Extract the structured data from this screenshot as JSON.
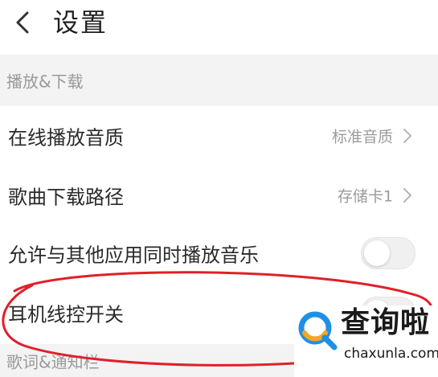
{
  "header": {
    "title": "设置",
    "back_icon": "chevron-left-icon"
  },
  "sections": [
    {
      "label": "播放&下载",
      "rows": [
        {
          "label": "在线播放音质",
          "value": "标准音质",
          "control": "chevron"
        },
        {
          "label": "歌曲下载路径",
          "value": "存储卡1",
          "control": "chevron"
        },
        {
          "label": "允许与其他应用同时播放音乐",
          "control": "toggle",
          "on": false
        },
        {
          "label": "耳机线控开关",
          "control": "toggle",
          "on": false
        }
      ]
    },
    {
      "label": "歌词&通知栏"
    }
  ],
  "watermark": {
    "brand": "查询啦",
    "url": "chaxunla.com",
    "icon": "magnifier-logo-icon"
  },
  "colors": {
    "section_bg": "#f3f3f3",
    "section_text": "#9a9a9a",
    "annotation": "#e0202a",
    "logo_blue": "#1e90e6",
    "logo_orange": "#f5a623"
  }
}
